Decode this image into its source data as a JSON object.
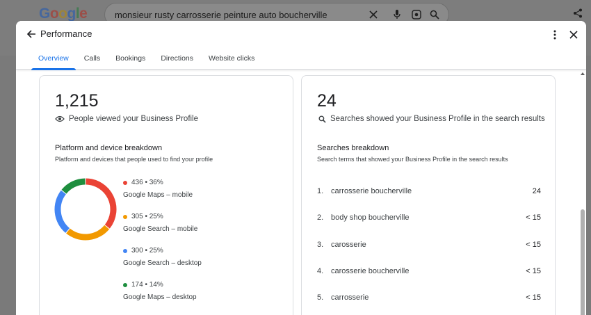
{
  "background": {
    "logo": "Google",
    "search_query": "monsieur rusty carrosserie peinture auto boucherville"
  },
  "dialog": {
    "title": "Performance",
    "tabs": [
      {
        "label": "Overview",
        "active": true
      },
      {
        "label": "Calls",
        "active": false
      },
      {
        "label": "Bookings",
        "active": false
      },
      {
        "label": "Directions",
        "active": false
      },
      {
        "label": "Website clicks",
        "active": false
      }
    ]
  },
  "views_card": {
    "count": "1,215",
    "caption": "People viewed your Business Profile",
    "section_title": "Platform and device breakdown",
    "section_subtitle": "Platform and devices that people used to find your profile",
    "breakdown": [
      {
        "stat": "436 • 36%",
        "label": "Google Maps – mobile",
        "value": 436,
        "percent": 36,
        "color": "#ea4335"
      },
      {
        "stat": "305 • 25%",
        "label": "Google Search – mobile",
        "value": 305,
        "percent": 25,
        "color": "#f29900"
      },
      {
        "stat": "300 • 25%",
        "label": "Google Search – desktop",
        "value": 300,
        "percent": 25,
        "color": "#4285f4"
      },
      {
        "stat": "174 • 14%",
        "label": "Google Maps – desktop",
        "value": 174,
        "percent": 14,
        "color": "#1e8e3e"
      }
    ]
  },
  "searches_card": {
    "count": "24",
    "caption": "Searches showed your Business Profile in the search results",
    "section_title": "Searches breakdown",
    "section_subtitle": "Search terms that showed your Business Profile in the search results",
    "rows": [
      {
        "index": "1.",
        "term": "carrosserie boucherville",
        "count": "24"
      },
      {
        "index": "2.",
        "term": "body shop boucherville",
        "count": "< 15"
      },
      {
        "index": "3.",
        "term": "carosserie",
        "count": "< 15"
      },
      {
        "index": "4.",
        "term": "carosserie boucherville",
        "count": "< 15"
      },
      {
        "index": "5.",
        "term": "carrosserie",
        "count": "< 15"
      }
    ]
  },
  "icons": {
    "back": "arrow-back-icon",
    "more": "more-vert-icon",
    "close": "close-icon",
    "views": "eye-icon",
    "searches": "search-icon"
  },
  "colors": {
    "accent": "#1a73e8",
    "text": "#202124"
  }
}
